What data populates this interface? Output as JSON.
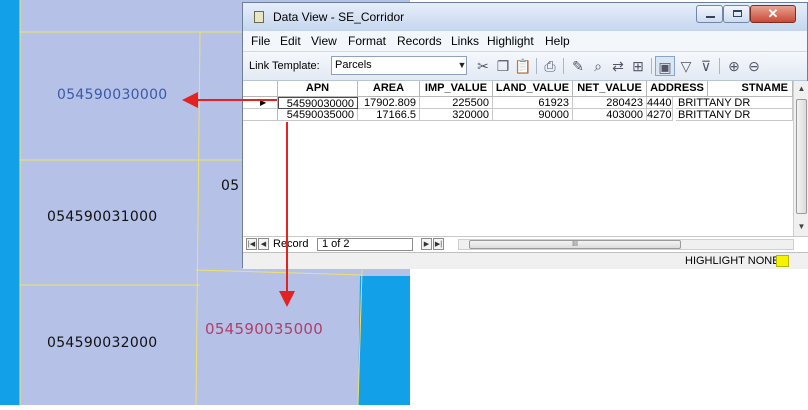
{
  "map": {
    "parcels": [
      {
        "id": "p1",
        "label": "054590030000"
      },
      {
        "id": "p2",
        "label": "054590031000"
      },
      {
        "id": "p3",
        "label": "054590032000"
      },
      {
        "id": "p4",
        "label": "054590035000"
      },
      {
        "id": "p5",
        "label": "05"
      }
    ],
    "colors": {
      "parcel_fill": "#b6c1e8",
      "parcel_line": "#efe26a",
      "water": "#12a1e9",
      "arrow": "#e32222",
      "label_blue": "#3a5aa8",
      "label_pink": "#b04068"
    }
  },
  "window": {
    "title": "Data View - SE_Corridor",
    "title_icon": "table-icon",
    "controls": {
      "minimize": "minimize-icon",
      "maximize": "maximize-icon",
      "close": "close-icon",
      "close_glyph": "✕"
    }
  },
  "menu": [
    "File",
    "Edit",
    "View",
    "Format",
    "Records",
    "Links",
    "Highlight",
    "Help"
  ],
  "toolbar": {
    "link_template_label": "Link Template:",
    "link_template_value": "Parcels",
    "icons": [
      "cut-icon",
      "copy-icon",
      "paste-icon",
      "print-icon",
      "edit-icon",
      "find-icon",
      "replace-icon",
      "map-link-icon",
      "select-icon",
      "filter-icon",
      "filter-clear-icon",
      "add-record-icon",
      "delete-record-icon"
    ]
  },
  "grid": {
    "columns": [
      "APN",
      "AREA",
      "IMP_VALUE",
      "LAND_VALUE",
      "NET_VALUE",
      "ADDRESS",
      "STNAME"
    ],
    "rows": [
      [
        "54590030000",
        "17902.809",
        "225500",
        "61923",
        "280423",
        "4440",
        "BRITTANY DR"
      ],
      [
        "54590035000",
        "17166.5",
        "320000",
        "90000",
        "403000",
        "4270",
        "BRITTANY DR"
      ]
    ],
    "current_record_marker": "▶",
    "scroll_arrows": {
      "up": "▲",
      "down": "▼",
      "left": "◀",
      "right": "▶"
    },
    "scroll_grip": "III"
  },
  "navigator": {
    "record_label": "Record",
    "record_value": "1 of 2",
    "buttons": {
      "first": "|◀",
      "prev": "◀",
      "next": "▶",
      "last": "▶|"
    }
  },
  "status": {
    "highlight": "HIGHLIGHT  NONE",
    "highlight_color": "#f4f400"
  }
}
